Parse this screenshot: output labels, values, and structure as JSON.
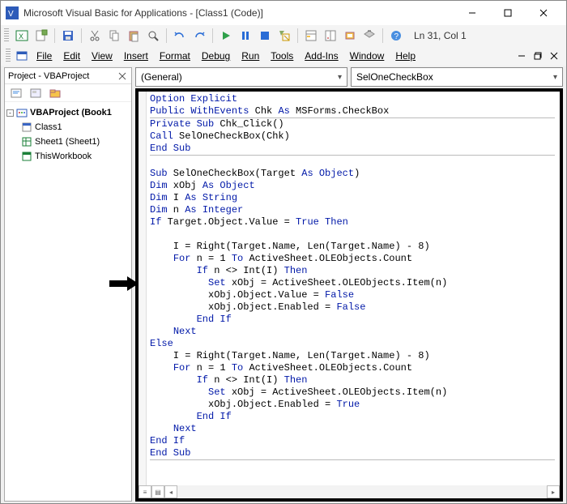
{
  "window": {
    "title": "Microsoft Visual Basic for Applications - [Class1 (Code)]"
  },
  "status": {
    "cursor": "Ln 31, Col 1"
  },
  "menu": {
    "file": "File",
    "edit": "Edit",
    "view": "View",
    "insert": "Insert",
    "format": "Format",
    "debug": "Debug",
    "run": "Run",
    "tools": "Tools",
    "addins": "Add-Ins",
    "window": "Window",
    "help": "Help"
  },
  "project": {
    "title": "Project - VBAProject",
    "root": "VBAProject (Book1",
    "class1": "Class1",
    "sheet1": "Sheet1 (Sheet1)",
    "thiswb": "ThisWorkbook"
  },
  "dropdowns": {
    "left": "(General)",
    "right": "SelOneCheckBox"
  },
  "code": {
    "l1a": "Option Explicit",
    "l2a": "Public WithEvents",
    "l2b": " Chk ",
    "l2c": "As",
    "l2d": " MSForms.CheckBox",
    "l3a": "Private Sub",
    "l3b": " Chk_Click()",
    "l4a": "Call",
    "l4b": " SelOneCheckBox(Chk)",
    "l5a": "End Sub",
    "l6": "",
    "l7a": "Sub",
    "l7b": " SelOneCheckBox(Target ",
    "l7c": "As Object",
    "l7d": ")",
    "l8a": "Dim",
    "l8b": " xObj ",
    "l8c": "As Object",
    "l9a": "Dim",
    "l9b": " I ",
    "l9c": "As String",
    "l10a": "Dim",
    "l10b": " n ",
    "l10c": "As Integer",
    "l11a": "If",
    "l11b": " Target.Object.Value = ",
    "l11c": "True Then",
    "l12": "",
    "l13a": "    I = Right(Target.Name, Len(Target.Name) - 8)",
    "l14a": "    ",
    "l14b": "For",
    "l14c": " n = 1 ",
    "l14d": "To",
    "l14e": " ActiveSheet.OLEObjects.Count",
    "l15a": "        ",
    "l15b": "If",
    "l15c": " n <> Int(I) ",
    "l15d": "Then",
    "l16a": "          ",
    "l16b": "Set",
    "l16c": " xObj = ActiveSheet.OLEObjects.Item(n)",
    "l17a": "          xObj.Object.Value = ",
    "l17b": "False",
    "l18a": "          xObj.Object.Enabled = ",
    "l18b": "False",
    "l19a": "        ",
    "l19b": "End If",
    "l20a": "    ",
    "l20b": "Next",
    "l21a": "Else",
    "l22a": "    I = Right(Target.Name, Len(Target.Name) - 8)",
    "l23a": "    ",
    "l23b": "For",
    "l23c": " n = 1 ",
    "l23d": "To",
    "l23e": " ActiveSheet.OLEObjects.Count",
    "l24a": "        ",
    "l24b": "If",
    "l24c": " n <> Int(I) ",
    "l24d": "Then",
    "l25a": "          ",
    "l25b": "Set",
    "l25c": " xObj = ActiveSheet.OLEObjects.Item(n)",
    "l26a": "          xObj.Object.Enabled = ",
    "l26b": "True",
    "l27a": "        ",
    "l27b": "End If",
    "l28a": "    ",
    "l28b": "Next",
    "l29a": "End If",
    "l30a": "End Sub"
  }
}
